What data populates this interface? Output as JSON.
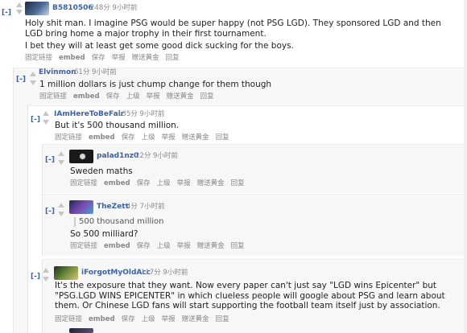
{
  "comments": [
    {
      "toggle": "[-]",
      "author": "B5810506",
      "meta": "248分 9小时前",
      "body": [
        "Holy shit man. I imagine PSG would be super happy (not PSG LGD). They sponsored LGD and then LGD bring home a major trophy in their first tournament.",
        "I bet they will at least get some good dick sucking for the boys."
      ],
      "actions": [
        "固定链接",
        "embed",
        "保存",
        "举报",
        "赠送黄金",
        "回复"
      ]
    },
    {
      "toggle": "[-]",
      "author": "Elvinmon",
      "meta": "61分 9小时前",
      "body": [
        "1 million dollars is just chump change for them though"
      ],
      "actions": [
        "固定链接",
        "embed",
        "保存",
        "上级",
        "举报",
        "赠送黄金",
        "回复"
      ]
    },
    {
      "toggle": "[-]",
      "author": "IAmHereToBeFair",
      "meta": "135分 9小时前",
      "body": [
        "But it's 500 thousand million."
      ],
      "actions": [
        "固定链接",
        "embed",
        "保存",
        "上级",
        "举报",
        "赠送黄金",
        "回复"
      ]
    },
    {
      "toggle": "[-]",
      "author": "palad1nz0",
      "meta": "22分 9小时前",
      "body": [
        "Sweden maths"
      ],
      "actions": [
        "固定链接",
        "embed",
        "保存",
        "上级",
        "举报",
        "赠送黄金",
        "回复"
      ]
    },
    {
      "toggle": "[-]",
      "author": "TheZett",
      "meta": "4分 7小时前",
      "quote": "500 thousand million",
      "body": [
        "So 500 milliard?"
      ],
      "actions": [
        "固定链接",
        "embed",
        "保存",
        "上级",
        "举报",
        "赠送黄金",
        "回复"
      ]
    },
    {
      "toggle": "[-]",
      "author": "iForgotMyOldAcc",
      "meta": "117分 9小时前",
      "body": [
        "It's the exposure that they want. Now every paper can't just say \"LGD wins Epicenter\" but \"PSG.LGD WINS EPICENTER\" in which clueless people will google about PSG and learn about them. Or Chinese LGD fans will start supporting the football team itself just by association."
      ],
      "actions": [
        "固定链接",
        "embed",
        "保存",
        "上级",
        "举报",
        "赠送黄金",
        "回复"
      ]
    }
  ]
}
